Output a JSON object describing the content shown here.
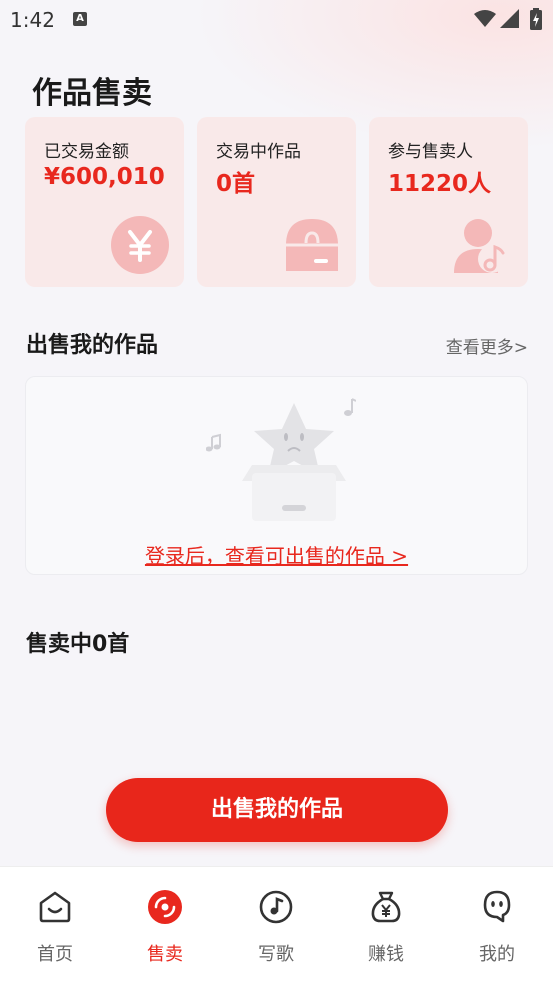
{
  "status_bar": {
    "time": "1:42",
    "notification_glyph": "A"
  },
  "page": {
    "title": "作品售卖"
  },
  "stats": [
    {
      "label": "已交易金额",
      "value": "¥600,010",
      "icon": "yen-coin-icon"
    },
    {
      "label": "交易中作品",
      "value": "0首",
      "icon": "box-icon"
    },
    {
      "label": "参与售卖人",
      "value": "11220人",
      "icon": "person-music-icon"
    }
  ],
  "sell_section": {
    "title": "出售我的作品",
    "more_label": "查看更多>",
    "empty_prompt": "登录后，查看可出售的作品 >"
  },
  "selling": {
    "count_label": "售卖中0首"
  },
  "primary_button": {
    "label": "出售我的作品"
  },
  "tabs": [
    {
      "label": "首页",
      "icon": "home-icon",
      "active": false
    },
    {
      "label": "售卖",
      "icon": "vinyl-icon",
      "active": true
    },
    {
      "label": "写歌",
      "icon": "music-note-icon",
      "active": false
    },
    {
      "label": "赚钱",
      "icon": "money-bag-icon",
      "active": false
    },
    {
      "label": "我的",
      "icon": "profile-icon",
      "active": false
    }
  ],
  "colors": {
    "accent": "#e8281e",
    "card_bg": "#f9e9e9",
    "page_bg": "#f6f5f9"
  }
}
